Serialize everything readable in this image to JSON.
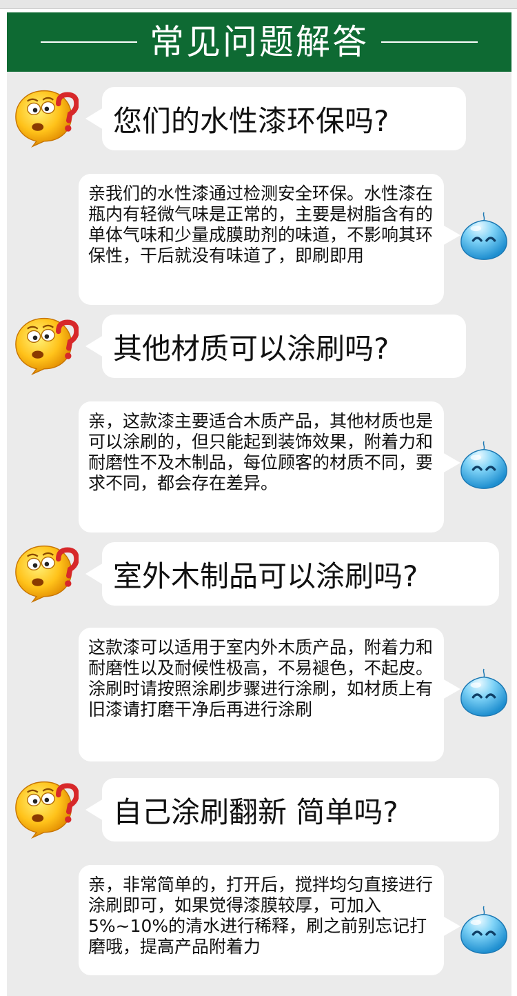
{
  "section": {
    "title": "常见问题解答",
    "accent_color": "#0e6a33",
    "background_color": "#ebebeb"
  },
  "qa": [
    {
      "question": "您们的水性漆环保吗?",
      "answer": "亲我们的水性漆通过检测安全环保。水性漆在瓶内有轻微气味是正常的，主要是树脂含有的单体气味和少量成膜助剂的味道，不影响其环保性，干后就没有味道了，即刷即用"
    },
    {
      "question": "其他材质可以涂刷吗?",
      "answer": "亲，这款漆主要适合木质产品，其他材质也是可以涂刷的，但只能起到装饰效果，附着力和耐磨性不及木制品，每位顾客的材质不同，要求不同，都会存在差异。"
    },
    {
      "question": "室外木制品可以涂刷吗?",
      "answer": "这款漆可以适用于室内外木质产品，附着力和耐磨性以及耐候性极高，不易褪色，不起皮。涂刷时请按照涂刷步骤进行涂刷，如材质上有旧漆请打磨干净后再进行涂刷"
    },
    {
      "question": "自己涂刷翻新 简单吗?",
      "answer": "亲，非常简单的，打开后，搅拌均匀直接进行涂刷即可，如果觉得漆膜较厚，可加入5%~10%的清水进行稀释，刷之前别忘记打磨哦，提高产品附着力"
    }
  ],
  "icons": {
    "question_face": "confused-question-emoji-icon",
    "answer_face": "smiling-blue-droplet-icon"
  }
}
